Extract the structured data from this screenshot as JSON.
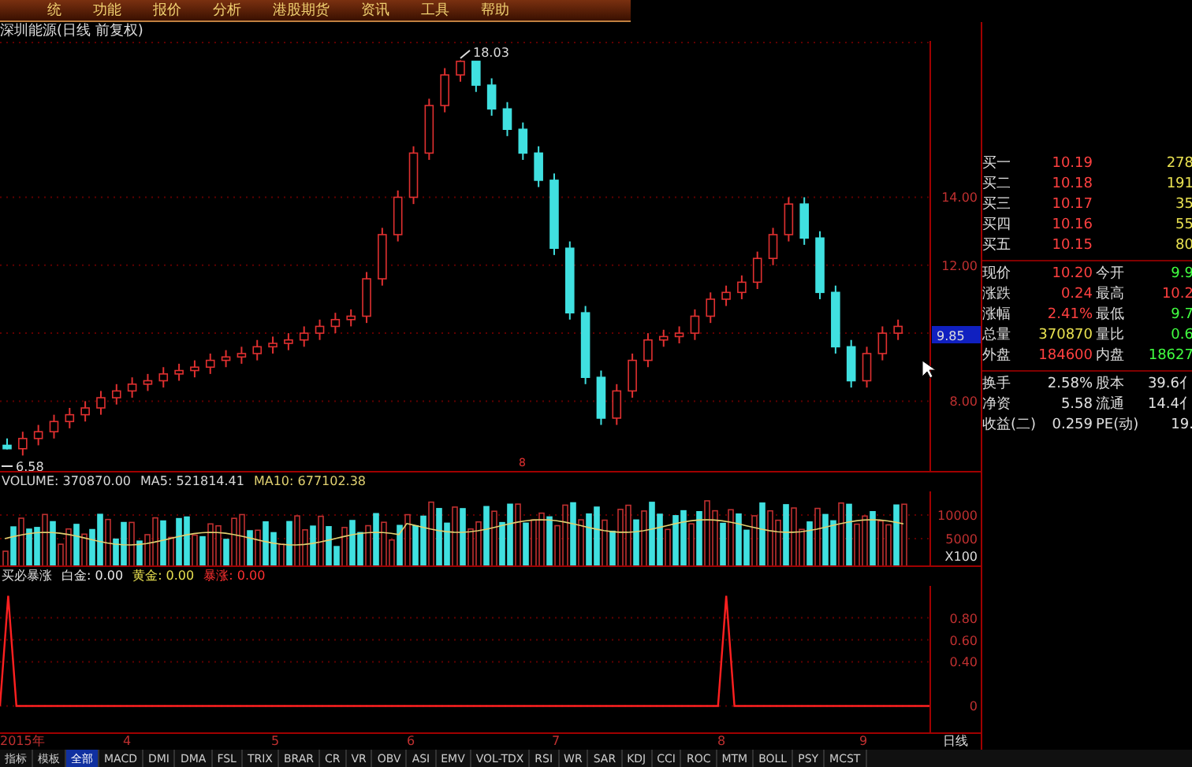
{
  "menu": [
    "统",
    "功能",
    "报价",
    "分析",
    "港股期货",
    "资讯",
    "工具",
    "帮助"
  ],
  "title": "深圳能源(日线 前复权)",
  "main_chart": {
    "high_label": "18.03",
    "low_label": "6.58",
    "marker": "8",
    "current_price": "9.85",
    "chart_data": {
      "type": "candlestick",
      "grid": true,
      "ylim": [
        5.9,
        18.6
      ],
      "yticks": [
        {
          "value": 14,
          "label": "14.00"
        },
        {
          "value": 12,
          "label": "12.00"
        },
        {
          "value": 8,
          "label": "8.00"
        }
      ],
      "ohlc": [
        [
          6.7,
          6.9,
          6.58,
          6.6
        ],
        [
          6.6,
          7.1,
          6.4,
          6.9
        ],
        [
          6.9,
          7.3,
          6.7,
          7.1
        ],
        [
          7.1,
          7.6,
          6.9,
          7.4
        ],
        [
          7.4,
          7.8,
          7.2,
          7.6
        ],
        [
          7.6,
          8.0,
          7.4,
          7.8
        ],
        [
          7.8,
          8.3,
          7.6,
          8.1
        ],
        [
          8.1,
          8.5,
          7.9,
          8.3
        ],
        [
          8.3,
          8.7,
          8.1,
          8.5
        ],
        [
          8.5,
          8.8,
          8.3,
          8.6
        ],
        [
          8.6,
          9.0,
          8.4,
          8.8
        ],
        [
          8.8,
          9.1,
          8.6,
          8.9
        ],
        [
          8.9,
          9.2,
          8.7,
          9.0
        ],
        [
          9.0,
          9.4,
          8.8,
          9.2
        ],
        [
          9.2,
          9.5,
          9.0,
          9.3
        ],
        [
          9.3,
          9.6,
          9.1,
          9.4
        ],
        [
          9.4,
          9.8,
          9.2,
          9.6
        ],
        [
          9.6,
          9.9,
          9.4,
          9.7
        ],
        [
          9.7,
          10.0,
          9.5,
          9.8
        ],
        [
          9.8,
          10.2,
          9.6,
          10.0
        ],
        [
          10.0,
          10.4,
          9.8,
          10.2
        ],
        [
          10.2,
          10.6,
          10.0,
          10.4
        ],
        [
          10.4,
          10.7,
          10.2,
          10.5
        ],
        [
          10.5,
          11.8,
          10.3,
          11.6
        ],
        [
          11.6,
          13.1,
          11.4,
          12.9
        ],
        [
          12.9,
          14.2,
          12.7,
          14.0
        ],
        [
          14.0,
          15.5,
          13.8,
          15.3
        ],
        [
          15.3,
          16.9,
          15.1,
          16.7
        ],
        [
          16.7,
          17.8,
          16.5,
          17.6
        ],
        [
          17.6,
          18.03,
          17.4,
          18.0
        ],
        [
          18.0,
          18.0,
          17.1,
          17.3
        ],
        [
          17.3,
          17.5,
          16.4,
          16.6
        ],
        [
          16.6,
          16.8,
          15.8,
          16.0
        ],
        [
          16.0,
          16.2,
          15.1,
          15.3
        ],
        [
          15.3,
          15.5,
          14.3,
          14.5
        ],
        [
          14.5,
          14.7,
          12.3,
          12.5
        ],
        [
          12.5,
          12.7,
          10.4,
          10.6
        ],
        [
          10.6,
          10.8,
          8.5,
          8.7
        ],
        [
          8.7,
          8.9,
          7.3,
          7.5
        ],
        [
          7.5,
          8.5,
          7.3,
          8.3
        ],
        [
          8.3,
          9.4,
          8.1,
          9.2
        ],
        [
          9.2,
          10.0,
          9.0,
          9.8
        ],
        [
          9.8,
          10.1,
          9.6,
          9.9
        ],
        [
          9.9,
          10.2,
          9.7,
          10.0
        ],
        [
          10.0,
          10.7,
          9.8,
          10.5
        ],
        [
          10.5,
          11.2,
          10.3,
          11.0
        ],
        [
          11.0,
          11.4,
          10.8,
          11.2
        ],
        [
          11.2,
          11.7,
          11.0,
          11.5
        ],
        [
          11.5,
          12.4,
          11.3,
          12.2
        ],
        [
          12.2,
          13.1,
          12.0,
          12.9
        ],
        [
          12.9,
          14.0,
          12.7,
          13.8
        ],
        [
          13.8,
          14.0,
          12.6,
          12.8
        ],
        [
          12.8,
          13.0,
          11.0,
          11.2
        ],
        [
          11.2,
          11.4,
          9.4,
          9.6
        ],
        [
          9.6,
          9.8,
          8.4,
          8.6
        ],
        [
          8.6,
          9.6,
          8.4,
          9.4
        ],
        [
          9.4,
          10.2,
          9.2,
          10.0
        ],
        [
          10.0,
          10.4,
          9.8,
          10.2
        ]
      ]
    }
  },
  "volume": {
    "readings": [
      {
        "text": "VOLUME: 370870.00",
        "color": "#d8d8d8"
      },
      {
        "text": "MA5: 521814.41",
        "color": "#d8d8d8"
      },
      {
        "text": "MA10: 677102.38",
        "color": "#e0d070"
      }
    ],
    "axis_ticks": [
      "10000",
      "5000",
      "X100"
    ]
  },
  "indicator": {
    "name": "买必暴涨",
    "readings": [
      {
        "text": "白金: 0.00",
        "color": "#e8e8e8"
      },
      {
        "text": "黄金: 0.00",
        "color": "#e8e050"
      },
      {
        "text": "暴涨: 0.00",
        "color": "#ff3030"
      }
    ],
    "chart_data": {
      "type": "line",
      "grid": true,
      "ylim": [
        -0.24,
        1.09
      ],
      "yticks": [
        {
          "value": 0.8,
          "label": "0.80"
        },
        {
          "value": 0.6,
          "label": "0.60"
        },
        {
          "value": 0.4,
          "label": "0.40"
        },
        {
          "value": 0,
          "label": "0"
        }
      ],
      "series": [
        {
          "color": "#ff2020",
          "values": [
            0,
            1,
            0,
            0,
            0,
            0,
            0,
            0,
            0,
            0,
            0,
            0,
            0,
            0,
            0,
            0,
            0,
            0,
            0,
            0,
            0,
            0,
            0,
            0,
            0,
            0,
            0,
            0,
            0,
            0,
            0,
            0,
            0,
            0,
            0,
            0,
            0,
            0,
            0,
            0,
            0,
            0,
            0,
            0,
            0,
            0,
            0,
            0,
            0,
            0,
            0,
            0,
            0,
            0,
            0,
            0,
            0,
            0,
            0,
            0,
            0,
            0,
            0,
            0,
            0,
            0,
            0,
            0,
            0,
            0,
            0,
            0,
            0,
            0,
            0,
            0,
            0,
            0,
            0,
            0,
            0,
            0,
            0,
            0,
            0,
            0,
            0,
            0,
            0,
            1,
            0,
            0,
            0,
            0,
            0,
            0,
            0,
            0,
            0,
            0,
            0,
            0,
            0,
            0,
            0,
            0,
            0,
            0,
            0,
            0,
            0,
            0,
            0,
            0,
            0
          ]
        }
      ]
    }
  },
  "dates": [
    "2015年",
    "4",
    "5",
    "6",
    "7",
    "8",
    "9"
  ],
  "period": "日线",
  "tabs": [
    {
      "label": "指标",
      "selected": false
    },
    {
      "label": "模板",
      "selected": false
    },
    {
      "label": "全部",
      "selected": true
    },
    {
      "label": "MACD",
      "selected": false
    },
    {
      "label": "DMI",
      "selected": false
    },
    {
      "label": "DMA",
      "selected": false
    },
    {
      "label": "FSL",
      "selected": false
    },
    {
      "label": "TRIX",
      "selected": false
    },
    {
      "label": "BRAR",
      "selected": false
    },
    {
      "label": "CR",
      "selected": false
    },
    {
      "label": "VR",
      "selected": false
    },
    {
      "label": "OBV",
      "selected": false
    },
    {
      "label": "ASI",
      "selected": false
    },
    {
      "label": "EMV",
      "selected": false
    },
    {
      "label": "VOL-TDX",
      "selected": false
    },
    {
      "label": "RSI",
      "selected": false
    },
    {
      "label": "WR",
      "selected": false
    },
    {
      "label": "SAR",
      "selected": false
    },
    {
      "label": "KDJ",
      "selected": false
    },
    {
      "label": "CCI",
      "selected": false
    },
    {
      "label": "ROC",
      "selected": false
    },
    {
      "label": "MTM",
      "selected": false
    },
    {
      "label": "BOLL",
      "selected": false
    },
    {
      "label": "PSY",
      "selected": false
    },
    {
      "label": "MCST",
      "selected": false
    }
  ],
  "quote_panel": {
    "bids": [
      {
        "name": "买一",
        "price": "10.19",
        "volume": "278"
      },
      {
        "name": "买二",
        "price": "10.18",
        "volume": "191"
      },
      {
        "name": "买三",
        "price": "10.17",
        "volume": "35"
      },
      {
        "name": "买四",
        "price": "10.16",
        "volume": "55"
      },
      {
        "name": "买五",
        "price": "10.15",
        "volume": "80"
      }
    ],
    "stats": [
      {
        "cells": [
          {
            "label": "现价",
            "value": "10.20",
            "color": "#ff4040"
          },
          {
            "label": "今开",
            "value": "9.9",
            "color": "#40ff40"
          }
        ]
      },
      {
        "cells": [
          {
            "label": "涨跌",
            "value": "0.24",
            "color": "#ff4040"
          },
          {
            "label": "最高",
            "value": "10.2",
            "color": "#ff4040"
          }
        ]
      },
      {
        "cells": [
          {
            "label": "涨幅",
            "value": "2.41%",
            "color": "#ff4040"
          },
          {
            "label": "最低",
            "value": "9.7",
            "color": "#40ff40"
          }
        ]
      },
      {
        "cells": [
          {
            "label": "总量",
            "value": "370870",
            "color": "#e8e050"
          },
          {
            "label": "量比",
            "value": "0.6",
            "color": "#40ff40"
          }
        ]
      },
      {
        "cells": [
          {
            "label": "外盘",
            "value": "184600",
            "color": "#ff4040"
          },
          {
            "label": "内盘",
            "value": "18627",
            "color": "#40ff40"
          }
        ]
      }
    ],
    "extra": [
      {
        "cells": [
          {
            "label": "换手",
            "value": "2.58%",
            "color": "#e0e0e0"
          },
          {
            "label": "股本",
            "value": "39.6亻",
            "color": "#e0e0e0"
          }
        ]
      },
      {
        "cells": [
          {
            "label": "净资",
            "value": "5.58",
            "color": "#e0e0e0"
          },
          {
            "label": "流通",
            "value": "14.4亻",
            "color": "#e0e0e0"
          }
        ]
      },
      {
        "cells": [
          {
            "label": "收益(二)",
            "value": "0.259",
            "color": "#e0e0e0"
          },
          {
            "label": "PE(动)",
            "value": "19.",
            "color": "#e0e0e0"
          }
        ]
      }
    ]
  }
}
